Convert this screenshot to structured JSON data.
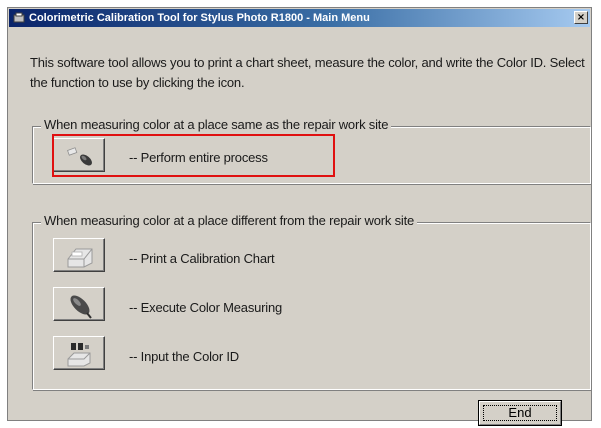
{
  "window": {
    "title": "Colorimetric Calibration Tool for Stylus Photo R1800 - Main Menu",
    "close_glyph": "×"
  },
  "intro": {
    "text": "This software tool allows you to print a chart sheet, measure the color, and write the Color ID. Select the function to use by clicking the icon."
  },
  "group_same": {
    "title": "When measuring color at a place same as the repair work site",
    "items": [
      {
        "label": "-- Perform entire process",
        "icon": "measure-process-icon"
      }
    ]
  },
  "group_different": {
    "title": "When measuring color at a place different from the repair work site",
    "items": [
      {
        "label": "-- Print a Calibration Chart",
        "icon": "printer-icon"
      },
      {
        "label": "-- Execute Color Measuring",
        "icon": "colorimeter-icon"
      },
      {
        "label": "-- Input the Color ID",
        "icon": "color-id-icon"
      }
    ]
  },
  "footer": {
    "end_label": "End"
  },
  "colors": {
    "dialog_bg": "#d4d0c8",
    "title_bar_start": "#0a246a",
    "title_bar_end": "#a6caf0",
    "highlight_border": "#e01010"
  }
}
